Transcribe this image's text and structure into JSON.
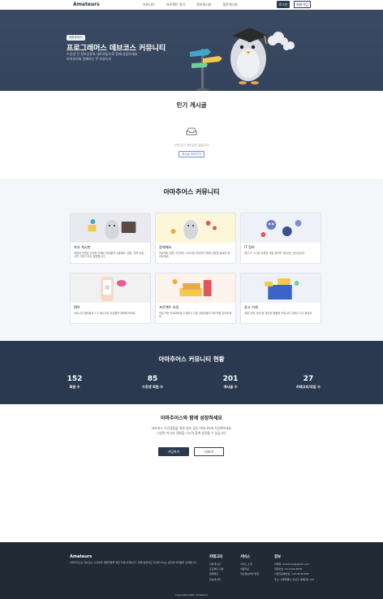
{
  "nav": {
    "logo": "Amateurs",
    "links": [
      "커뮤니티",
      "프로젝트 찾기",
      "정보게시판",
      "질문게시판"
    ],
    "login": "로그인",
    "signup": "회원가입"
  },
  "hero": {
    "badge": "아마추어스",
    "title": "프로그래머스 데브코스 커뮤니티",
    "subtitle1": "수강생 간 정보공유와 네트워킹으로 함께 성장하세요",
    "subtitle2": "아마추어와 함께하는 IT 커뮤니티"
  },
  "popular": {
    "title": "인기 게시글",
    "empty_text": "아직 인기 게시글이 없습니다",
    "write_button": "게시글 보러가기"
  },
  "community": {
    "title": "아마추어스 커뮤니티",
    "cards": [
      {
        "title": "자유 게시판",
        "desc": "개발과 관련된 다양한 주제로 자유롭게 소통해요. 잡담, 정보 공유, 고민 이야기 모두 환영합니다."
      },
      {
        "title": "함께해요",
        "desc": "프로젝트 팀원 구인부터 스터디원 모집까지 함께 성장할 동료를 찾아보세요."
      },
      {
        "title": "IT 정보",
        "desc": "최신 IT 소식과 유용한 개발 정보를 공유하는 공간입니다."
      },
      {
        "title": "DM",
        "desc": "커뮤니티 멤버들과 1:1 메시지로 자유롭게 대화해 보세요."
      },
      {
        "title": "프로젝트 자랑",
        "desc": "직접 만든 프로젝트를 소개하고 다른 개발자들의 피드백을 받아보세요."
      },
      {
        "title": "중고 거래",
        "desc": "개발 서적, 장비 등 필요한 물품을 커뮤니티 안에서 사고 팔아요."
      }
    ]
  },
  "stats": {
    "title": "아마추어스 커뮤니티 현황",
    "items": [
      {
        "num": "152",
        "label": "회원 수"
      },
      {
        "num": "85",
        "label": "수강생 회원 수"
      },
      {
        "num": "201",
        "label": "게시글 수"
      },
      {
        "num": "27",
        "label": "카테고리/모임 수"
      }
    ]
  },
  "grow": {
    "title": "아마추어스와 함께 성장하세요",
    "sub1": "데브코스 수강생들을 위한 정보 공유 커뮤니티에 가입해보세요",
    "sub2": "다양한 지식과 경험을 나누며 함께 성장할 수 있습니다",
    "join": "가입하기",
    "more": "더보기"
  },
  "footer": {
    "brand": "Amateurs",
    "desc": "아마추어스는 데브코스 수강생과 개발자들을 위한 커뮤니티입니다. 함께 성장하고 지식을 나누는 공간에 여러분을 초대합니다.",
    "cols": [
      {
        "h": "카테고리",
        "items": [
          "자유게시판",
          "프로젝트 자랑",
          "함께해요",
          "정보게시판"
        ]
      },
      {
        "h": "서비스",
        "items": [
          "서비스 소개",
          "이용약관",
          "개인정보처리 방침"
        ]
      },
      {
        "h": "정보",
        "items": [
          "이메일: amateurs@gmail.com",
          "전화번호: 02-1234-5678",
          "사업자등록번호: 123-45-67890",
          "주소: 서울특별시 강남구 테헤란로 123"
        ]
      }
    ],
    "copyright": "Copyright 2025. Amateurs"
  },
  "colors": {
    "primary": "#2b3950",
    "hero_bg": "#3a4a63",
    "footer_bg": "#222a36",
    "accent_blue": "#4a6fc9"
  }
}
